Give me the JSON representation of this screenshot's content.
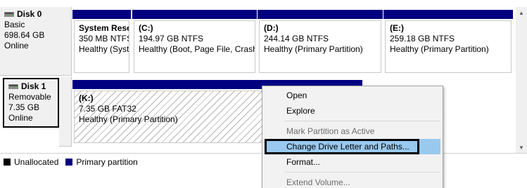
{
  "disks": [
    {
      "name": "Disk 0",
      "type": "Basic",
      "size": "698.64 GB",
      "status": "Online"
    },
    {
      "name": "Disk 1",
      "type": "Removable",
      "size": "7.35 GB",
      "status": "Online"
    }
  ],
  "disk0_partitions": [
    {
      "name": "System Rese",
      "info": "350 MB NTFS",
      "status": "Healthy (Syst"
    },
    {
      "name": "(C:)",
      "info": "194.97 GB NTFS",
      "status": "Healthy (Boot, Page File, Crash"
    },
    {
      "name": "(D:)",
      "info": "244.14 GB NTFS",
      "status": "Healthy (Primary Partition)"
    },
    {
      "name": "(E:)",
      "info": "259.18 GB NTFS",
      "status": "Healthy (Primary Partition)"
    }
  ],
  "disk1_partition": {
    "name": "(K:)",
    "info": "7.35 GB FAT32",
    "status": "Healthy (Primary Partition)"
  },
  "legend": [
    {
      "label": "Unallocated",
      "color": "#000000"
    },
    {
      "label": "Primary partition",
      "color": "#000080"
    }
  ],
  "context_menu": {
    "items": [
      {
        "label": "Open",
        "enabled": true
      },
      {
        "label": "Explore",
        "enabled": true
      },
      {
        "label": "Mark Partition as Active",
        "enabled": false
      },
      {
        "label": "Change Drive Letter and Paths...",
        "enabled": true,
        "highlighted": true
      },
      {
        "label": "Format...",
        "enabled": true
      },
      {
        "label": "Extend Volume...",
        "enabled": false
      }
    ]
  },
  "colors": {
    "partition_bar": "#000080",
    "menu_highlight": "#99c9ef"
  }
}
